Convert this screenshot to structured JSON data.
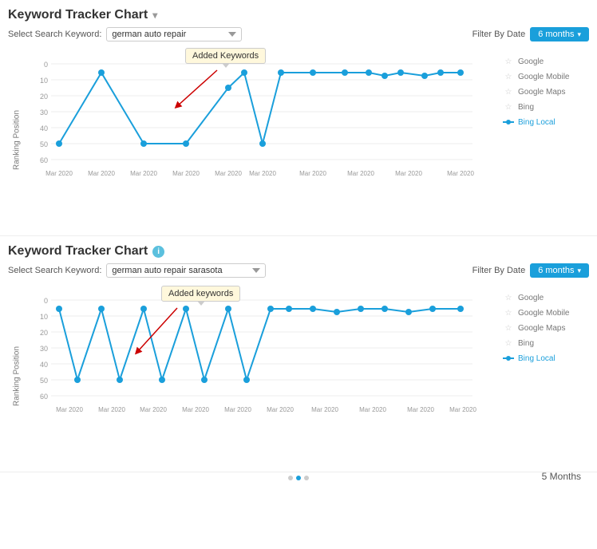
{
  "chart1": {
    "title": "Keyword Tracker Chart",
    "title_suffix": "",
    "show_info": false,
    "select_label": "Select Search Keyword:",
    "keyword_value": "german auto repair",
    "filter_label": "Filter By Date",
    "filter_value": "6 months",
    "tooltip": "Added Keywords",
    "y_axis_label": "Ranking Position",
    "legend": [
      {
        "label": "Google",
        "active": false,
        "icon": "star-outline"
      },
      {
        "label": "Google Mobile",
        "active": false,
        "icon": "star-outline"
      },
      {
        "label": "Google Maps",
        "active": false,
        "icon": "star-outline"
      },
      {
        "label": "Bing",
        "active": false,
        "icon": "star-outline"
      },
      {
        "label": "Bing Local",
        "active": true,
        "icon": "dot-line"
      }
    ],
    "x_labels": [
      "Mar 2020",
      "Mar 2020",
      "Mar 2020",
      "Mar 2020",
      "Mar 2020",
      "Mar 2020",
      "Mar 2020",
      "Mar 2020",
      "Mar 2020",
      "Mar 2020"
    ]
  },
  "chart2": {
    "title": "Keyword Tracker Chart",
    "title_suffix": "",
    "show_info": true,
    "select_label": "Select Search Keyword:",
    "keyword_value": "german auto repair sarasota",
    "filter_label": "Filter By Date",
    "filter_value": "6 months",
    "tooltip": "Added keywords",
    "y_axis_label": "Ranking Position",
    "legend": [
      {
        "label": "Google",
        "active": false,
        "icon": "star-outline"
      },
      {
        "label": "Google Mobile",
        "active": false,
        "icon": "star-outline"
      },
      {
        "label": "Google Maps",
        "active": false,
        "icon": "star-outline"
      },
      {
        "label": "Bing",
        "active": false,
        "icon": "star-outline"
      },
      {
        "label": "Bing Local",
        "active": true,
        "icon": "dot-line"
      }
    ],
    "x_labels": [
      "Mar 2020",
      "Mar 2020",
      "Mar 2020",
      "Mar 2020",
      "Mar 2020",
      "Mar 2020",
      "Mar 2020",
      "Mar 2020",
      "Mar 2020",
      "Mar 2020"
    ]
  },
  "bottom_label": "5 Months"
}
